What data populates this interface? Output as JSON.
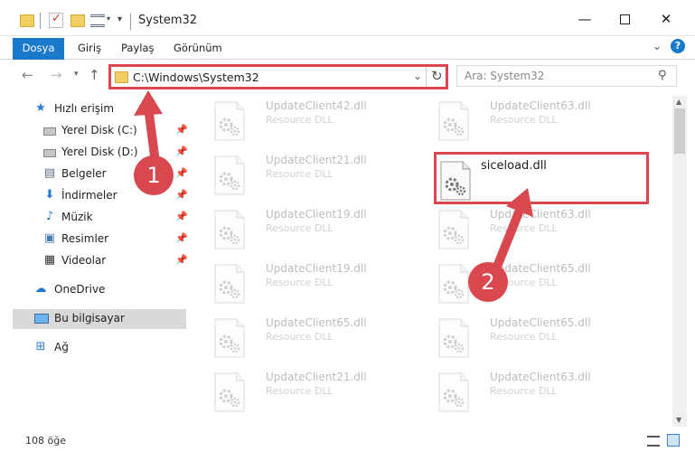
{
  "window": {
    "title": "System32"
  },
  "ribbon": {
    "tabs": [
      "Dosya",
      "Giriş",
      "Paylaş",
      "Görünüm"
    ],
    "help_label": "?"
  },
  "address": {
    "path": "C:\\Windows\\System32",
    "search_placeholder": "Ara: System32"
  },
  "sidebar": {
    "quick_access": "Hızlı erişim",
    "items": [
      {
        "label": "Yerel Disk (C:)",
        "icon": "drive-icon",
        "pinned": true
      },
      {
        "label": "Yerel Disk (D:)",
        "icon": "drive-icon",
        "pinned": true
      },
      {
        "label": "Belgeler",
        "icon": "documents-icon",
        "pinned": true
      },
      {
        "label": "İndirmeler",
        "icon": "download-icon",
        "pinned": true
      },
      {
        "label": "Müzik",
        "icon": "music-icon",
        "pinned": true
      },
      {
        "label": "Resimler",
        "icon": "pictures-icon",
        "pinned": true
      },
      {
        "label": "Videolar",
        "icon": "video-icon",
        "pinned": true
      }
    ],
    "onedrive": "OneDrive",
    "this_pc": "Bu bilgisayar",
    "network": "Ağ"
  },
  "files": {
    "left_column": [
      {
        "name": "UpdateClient42.dll",
        "type": "Resource DLL"
      },
      {
        "name": "UpdateClient21.dll",
        "type": "Resource DLL"
      },
      {
        "name": "UpdateClient19.dll",
        "type": "Resource DLL"
      },
      {
        "name": "UpdateClient19.dll",
        "type": "Resource DLL"
      },
      {
        "name": "UpdateClient65.dll",
        "type": "Resource DLL"
      },
      {
        "name": "UpdateClient21.dll",
        "type": "Resource DLL"
      }
    ],
    "right_column": [
      {
        "name": "UpdateClient63.dll",
        "type": "Resource DLL"
      },
      {
        "name": "siceload.dll",
        "type": ""
      },
      {
        "name": "UpdateClient63.dll",
        "type": "Resource DLL"
      },
      {
        "name": "UpdateClient65.dll",
        "type": "Resource DLL"
      },
      {
        "name": "UpdateClient65.dll",
        "type": "Resource DLL"
      },
      {
        "name": "UpdateClient63.dll",
        "type": "Resource DLL"
      }
    ],
    "highlighted": "siceload.dll"
  },
  "status": {
    "item_count": "108 öğe"
  },
  "annotations": {
    "step1": "1",
    "step2": "2",
    "color": "#d9484e"
  }
}
